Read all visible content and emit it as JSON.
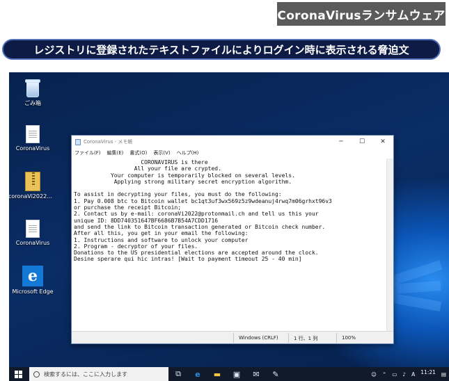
{
  "header": {
    "badge": "CoronaVirusランサムウェア",
    "caption": "レジストリに登録されたテキストファイルによりログイン時に表示される脅迫文"
  },
  "desktop_icons": [
    {
      "icon": "recycle-bin-icon",
      "label": "ごみ箱"
    },
    {
      "icon": "text-file-icon",
      "label": "CoronaVirus"
    },
    {
      "icon": "zip-file-icon",
      "label": "coronaVi2022@pr..."
    },
    {
      "icon": "text-file-icon",
      "label": "CoronaVirus"
    },
    {
      "icon": "edge-browser-icon",
      "label": "Microsoft Edge"
    }
  ],
  "notepad": {
    "title": "CoronaVirus - メモ帳",
    "menu": [
      "ファイル(F)",
      "編集(E)",
      "書式(O)",
      "表示(V)",
      "ヘルプ(H)"
    ],
    "content": "                    CORONAVIRUS is there\n                  All your file are crypted.\n           Your computer is temporarily blocked on several levels.\n            Applying strong military secret encryption algorithm.\n\nTo assist in decrypting your files, you must do the following:\n1. Pay 0.008 btc to Bitcoin wallet bc1qt3uf3wx569z5z9wdeanuj4rwq7m06grhxt96v3\nor purchase the receipt Bitcoin;\n2. Contact us by e-mail: coronaVi2022@protonmail.ch and tell us this your\nunique ID: 8DD740351647BF6686B7B54A7CDD1716\nand send the link to Bitcoin transaction generated or Bitcoin check number.\nAfter all this, you get in your email the following:\n1. Instructions and software to unlock your computer\n2. Program - decryptor of your files.\nDonations to the US presidential elections are accepted around the clock.\nDesine sperare qui hic intras! [Wait to payment timeout 25 - 40 min]",
    "status": {
      "encoding": "Windows (CRLF)",
      "position": "1 行、1 列",
      "zoom": "100%"
    }
  },
  "taskbar": {
    "search_placeholder": "検索するには、ここに入力します",
    "clock": "11:21"
  }
}
